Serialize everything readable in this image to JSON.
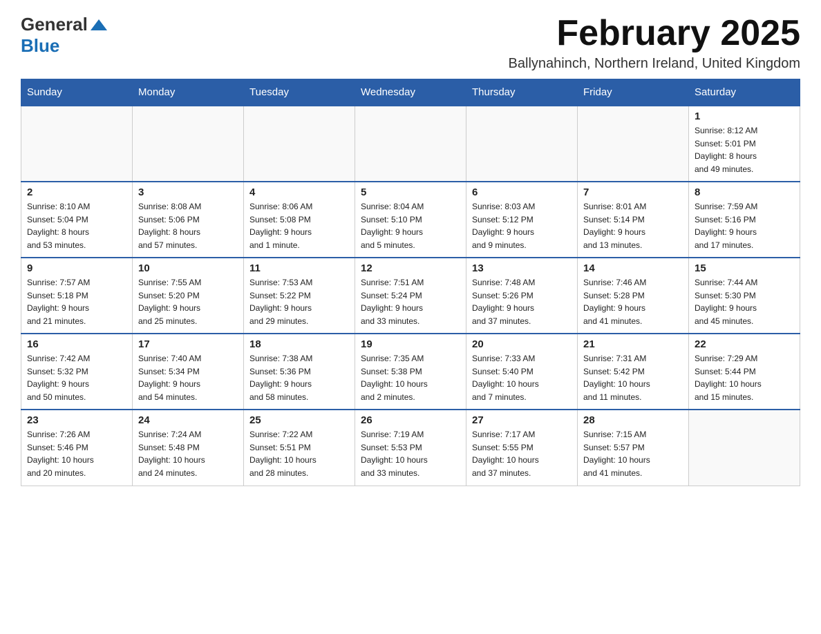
{
  "header": {
    "logo_general": "General",
    "logo_blue": "Blue",
    "month_title": "February 2025",
    "location": "Ballynahinch, Northern Ireland, United Kingdom"
  },
  "days_of_week": [
    "Sunday",
    "Monday",
    "Tuesday",
    "Wednesday",
    "Thursday",
    "Friday",
    "Saturday"
  ],
  "weeks": [
    [
      {
        "day": "",
        "info": ""
      },
      {
        "day": "",
        "info": ""
      },
      {
        "day": "",
        "info": ""
      },
      {
        "day": "",
        "info": ""
      },
      {
        "day": "",
        "info": ""
      },
      {
        "day": "",
        "info": ""
      },
      {
        "day": "1",
        "info": "Sunrise: 8:12 AM\nSunset: 5:01 PM\nDaylight: 8 hours\nand 49 minutes."
      }
    ],
    [
      {
        "day": "2",
        "info": "Sunrise: 8:10 AM\nSunset: 5:04 PM\nDaylight: 8 hours\nand 53 minutes."
      },
      {
        "day": "3",
        "info": "Sunrise: 8:08 AM\nSunset: 5:06 PM\nDaylight: 8 hours\nand 57 minutes."
      },
      {
        "day": "4",
        "info": "Sunrise: 8:06 AM\nSunset: 5:08 PM\nDaylight: 9 hours\nand 1 minute."
      },
      {
        "day": "5",
        "info": "Sunrise: 8:04 AM\nSunset: 5:10 PM\nDaylight: 9 hours\nand 5 minutes."
      },
      {
        "day": "6",
        "info": "Sunrise: 8:03 AM\nSunset: 5:12 PM\nDaylight: 9 hours\nand 9 minutes."
      },
      {
        "day": "7",
        "info": "Sunrise: 8:01 AM\nSunset: 5:14 PM\nDaylight: 9 hours\nand 13 minutes."
      },
      {
        "day": "8",
        "info": "Sunrise: 7:59 AM\nSunset: 5:16 PM\nDaylight: 9 hours\nand 17 minutes."
      }
    ],
    [
      {
        "day": "9",
        "info": "Sunrise: 7:57 AM\nSunset: 5:18 PM\nDaylight: 9 hours\nand 21 minutes."
      },
      {
        "day": "10",
        "info": "Sunrise: 7:55 AM\nSunset: 5:20 PM\nDaylight: 9 hours\nand 25 minutes."
      },
      {
        "day": "11",
        "info": "Sunrise: 7:53 AM\nSunset: 5:22 PM\nDaylight: 9 hours\nand 29 minutes."
      },
      {
        "day": "12",
        "info": "Sunrise: 7:51 AM\nSunset: 5:24 PM\nDaylight: 9 hours\nand 33 minutes."
      },
      {
        "day": "13",
        "info": "Sunrise: 7:48 AM\nSunset: 5:26 PM\nDaylight: 9 hours\nand 37 minutes."
      },
      {
        "day": "14",
        "info": "Sunrise: 7:46 AM\nSunset: 5:28 PM\nDaylight: 9 hours\nand 41 minutes."
      },
      {
        "day": "15",
        "info": "Sunrise: 7:44 AM\nSunset: 5:30 PM\nDaylight: 9 hours\nand 45 minutes."
      }
    ],
    [
      {
        "day": "16",
        "info": "Sunrise: 7:42 AM\nSunset: 5:32 PM\nDaylight: 9 hours\nand 50 minutes."
      },
      {
        "day": "17",
        "info": "Sunrise: 7:40 AM\nSunset: 5:34 PM\nDaylight: 9 hours\nand 54 minutes."
      },
      {
        "day": "18",
        "info": "Sunrise: 7:38 AM\nSunset: 5:36 PM\nDaylight: 9 hours\nand 58 minutes."
      },
      {
        "day": "19",
        "info": "Sunrise: 7:35 AM\nSunset: 5:38 PM\nDaylight: 10 hours\nand 2 minutes."
      },
      {
        "day": "20",
        "info": "Sunrise: 7:33 AM\nSunset: 5:40 PM\nDaylight: 10 hours\nand 7 minutes."
      },
      {
        "day": "21",
        "info": "Sunrise: 7:31 AM\nSunset: 5:42 PM\nDaylight: 10 hours\nand 11 minutes."
      },
      {
        "day": "22",
        "info": "Sunrise: 7:29 AM\nSunset: 5:44 PM\nDaylight: 10 hours\nand 15 minutes."
      }
    ],
    [
      {
        "day": "23",
        "info": "Sunrise: 7:26 AM\nSunset: 5:46 PM\nDaylight: 10 hours\nand 20 minutes."
      },
      {
        "day": "24",
        "info": "Sunrise: 7:24 AM\nSunset: 5:48 PM\nDaylight: 10 hours\nand 24 minutes."
      },
      {
        "day": "25",
        "info": "Sunrise: 7:22 AM\nSunset: 5:51 PM\nDaylight: 10 hours\nand 28 minutes."
      },
      {
        "day": "26",
        "info": "Sunrise: 7:19 AM\nSunset: 5:53 PM\nDaylight: 10 hours\nand 33 minutes."
      },
      {
        "day": "27",
        "info": "Sunrise: 7:17 AM\nSunset: 5:55 PM\nDaylight: 10 hours\nand 37 minutes."
      },
      {
        "day": "28",
        "info": "Sunrise: 7:15 AM\nSunset: 5:57 PM\nDaylight: 10 hours\nand 41 minutes."
      },
      {
        "day": "",
        "info": ""
      }
    ]
  ]
}
